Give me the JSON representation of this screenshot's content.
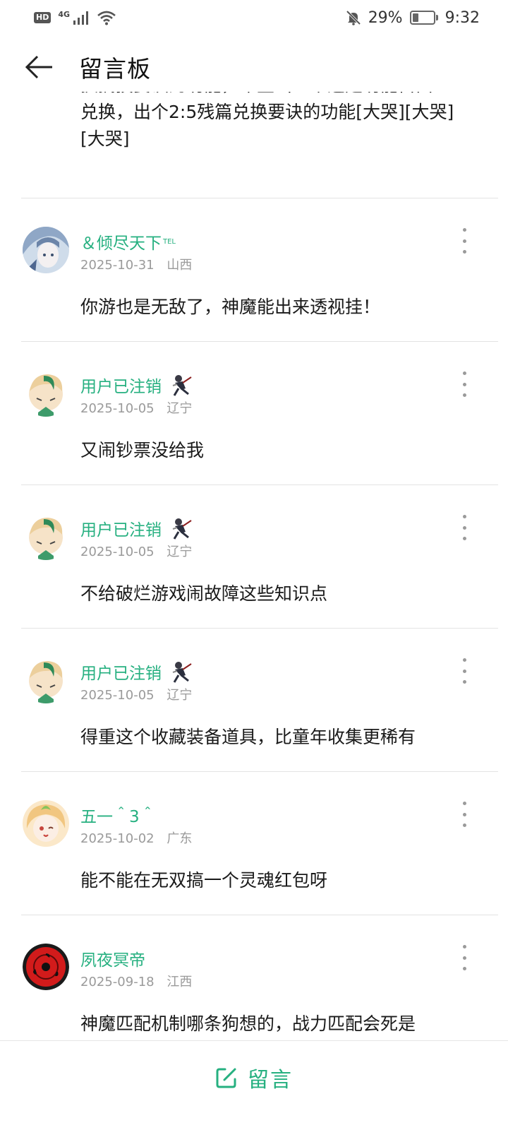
{
  "status_bar": {
    "hd": "HD",
    "network": "4G",
    "battery": "29%",
    "battery_level": 0.29,
    "time": "9:32"
  },
  "header": {
    "title": "留言板",
    "back_icon": "arrow-left-icon"
  },
  "partial_post": {
    "text_line1": "换搞技要诀的功能，希望出一个这是功能自由",
    "text_line2": "兑换，出个2:5残篇兑换要诀的功能[大哭][大哭]",
    "text_line3": "[大哭]"
  },
  "comments": [
    {
      "username": "＆倾尽天下",
      "tag": "TEL",
      "date": "2025-10-31",
      "location": "山西",
      "text": "你游也是无敌了，神魔能出来透视挂！",
      "avatar": "avatar-blue-anime"
    },
    {
      "username": "用户已注销",
      "date": "2025-10-05",
      "location": "辽宁",
      "text": "又闹钞票没给我",
      "avatar": "avatar-green-hair",
      "badge": "ninja-badge-icon"
    },
    {
      "username": "用户已注销",
      "date": "2025-10-05",
      "location": "辽宁",
      "text": "不给破烂游戏闹故障这些知识点",
      "avatar": "avatar-green-hair",
      "badge": "ninja-badge-icon"
    },
    {
      "username": "用户已注销",
      "date": "2025-10-05",
      "location": "辽宁",
      "text": "得重这个收藏装备道具，比童年收集更稀有",
      "avatar": "avatar-green-hair",
      "badge": "ninja-badge-icon"
    },
    {
      "username": "五一＾3＾",
      "date": "2025-10-02",
      "location": "广东",
      "text": "能不能在无双搞一个灵魂红包呀",
      "avatar": "avatar-anime-girl"
    },
    {
      "username": "夙夜冥帝",
      "date": "2025-09-18",
      "location": "江西",
      "text": "神魔匹配机制哪条狗想的，战力匹配会死是",
      "avatar": "avatar-sharingan"
    }
  ],
  "bottom": {
    "button_label": "留言",
    "icon": "edit-icon"
  },
  "colors": {
    "accent": "#26b080",
    "meta": "#9a9a9a"
  }
}
